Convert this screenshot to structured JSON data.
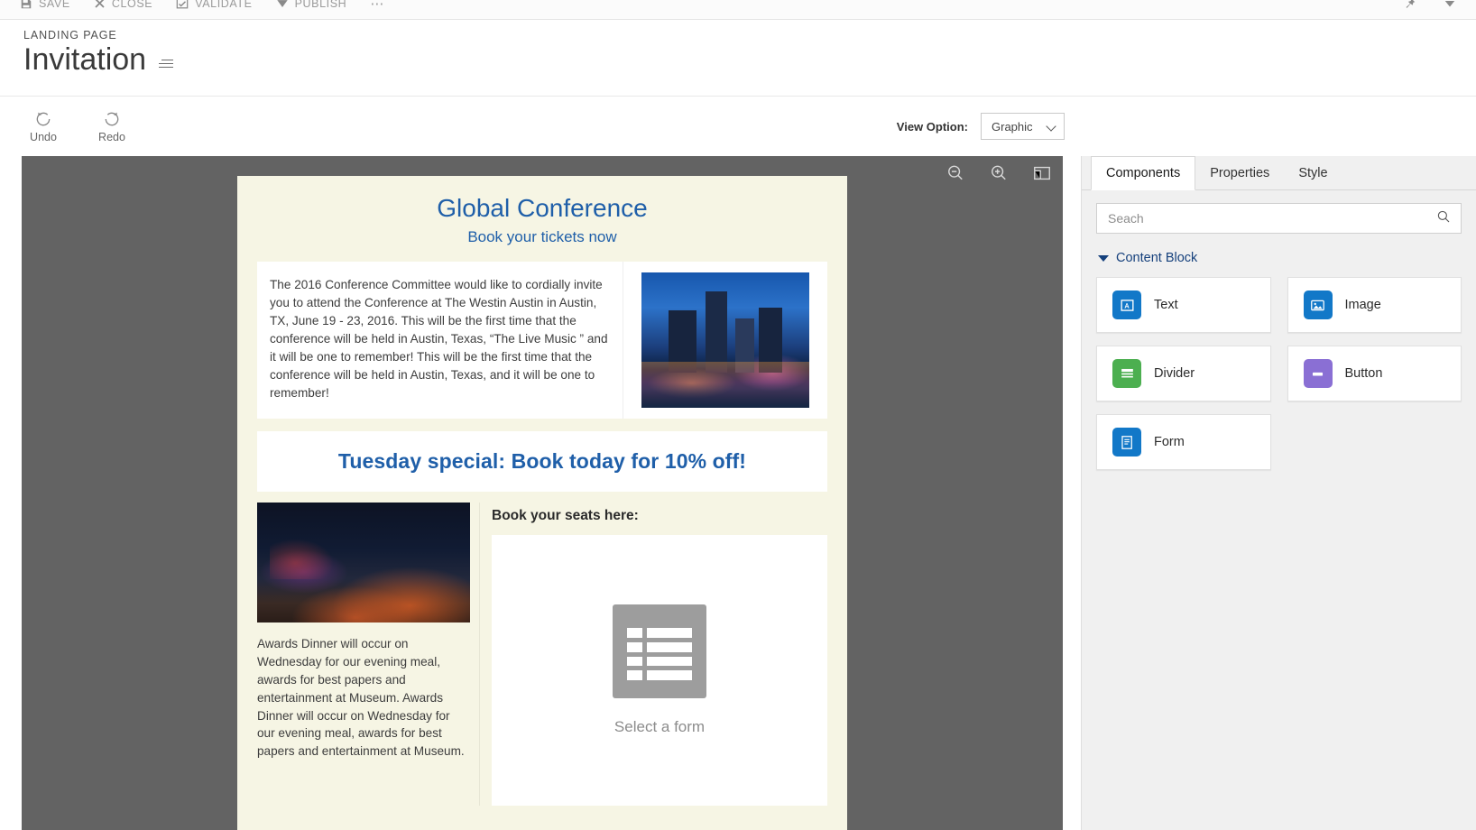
{
  "command_bar": {
    "items": [
      {
        "label": "SAVE",
        "icon": "save-icon"
      },
      {
        "label": "CLOSE",
        "icon": "close-x-icon"
      },
      {
        "label": "VALIDATE",
        "icon": "validate-icon"
      },
      {
        "label": "PUBLISH",
        "icon": "publish-chevron-icon"
      }
    ],
    "overflow": "⋯",
    "right_icons": [
      {
        "name": "pin-icon"
      },
      {
        "name": "chevron-down-icon"
      }
    ]
  },
  "header": {
    "eyebrow": "LANDING PAGE",
    "title": "Invitation",
    "menu_icon": "list-menu-icon"
  },
  "action_bar": {
    "undo_label": "Undo",
    "redo_label": "Redo",
    "view_option_label": "View Option:",
    "view_option_value": "Graphic",
    "view_option_choices": [
      "Graphic"
    ]
  },
  "canvas": {
    "toolbar": [
      {
        "name": "zoom-out-icon"
      },
      {
        "name": "zoom-in-icon"
      },
      {
        "name": "fit-to-screen-icon"
      }
    ],
    "page": {
      "title": "Global Conference",
      "subtitle": "Book your tickets now",
      "intro_paragraph": "The 2016 Conference Committee would like to cordially invite you to attend the Conference at The Westin Austin in Austin, TX, June 19 - 23, 2016. This will be the first time that the conference will be held in Austin, Texas, “The Live Music ” and it will be one to remember! This will be the first time that the conference will be held in Austin, Texas, and it will be one to remember!",
      "intro_image_alt": "austin-skyline-night-image",
      "banner_text": "Tuesday special: Book today for 10% off!",
      "audience_image_alt": "conference-audience-image",
      "awards_paragraph": "Awards Dinner will occur on Wednesday for our evening meal, awards for best papers and entertainment at Museum. Awards Dinner will occur on Wednesday for our evening meal, awards for best papers and entertainment at Museum.",
      "seats_label": "Book  your seats here:",
      "form_placeholder_text": "Select a form"
    }
  },
  "right_panel": {
    "tabs": [
      {
        "label": "Components",
        "active": true
      },
      {
        "label": "Properties",
        "active": false
      },
      {
        "label": "Style",
        "active": false
      }
    ],
    "search_placeholder": "Seach",
    "search_value": "",
    "section": {
      "title": "Content Block",
      "expanded": true
    },
    "blocks": [
      {
        "label": "Text",
        "icon": "text-block-icon",
        "color": "#1278c8"
      },
      {
        "label": "Image",
        "icon": "image-block-icon",
        "color": "#1278c8"
      },
      {
        "label": "Divider",
        "icon": "divider-block-icon",
        "color": "#4caf50"
      },
      {
        "label": "Button",
        "icon": "button-block-icon",
        "color": "#8a6fd4"
      },
      {
        "label": "Form",
        "icon": "form-block-icon",
        "color": "#1278c8"
      }
    ]
  },
  "colors": {
    "accent_blue": "#1f5fa9",
    "panel_link": "#15407c",
    "canvas_bg": "#636363",
    "page_bg": "#f6f5e4"
  }
}
